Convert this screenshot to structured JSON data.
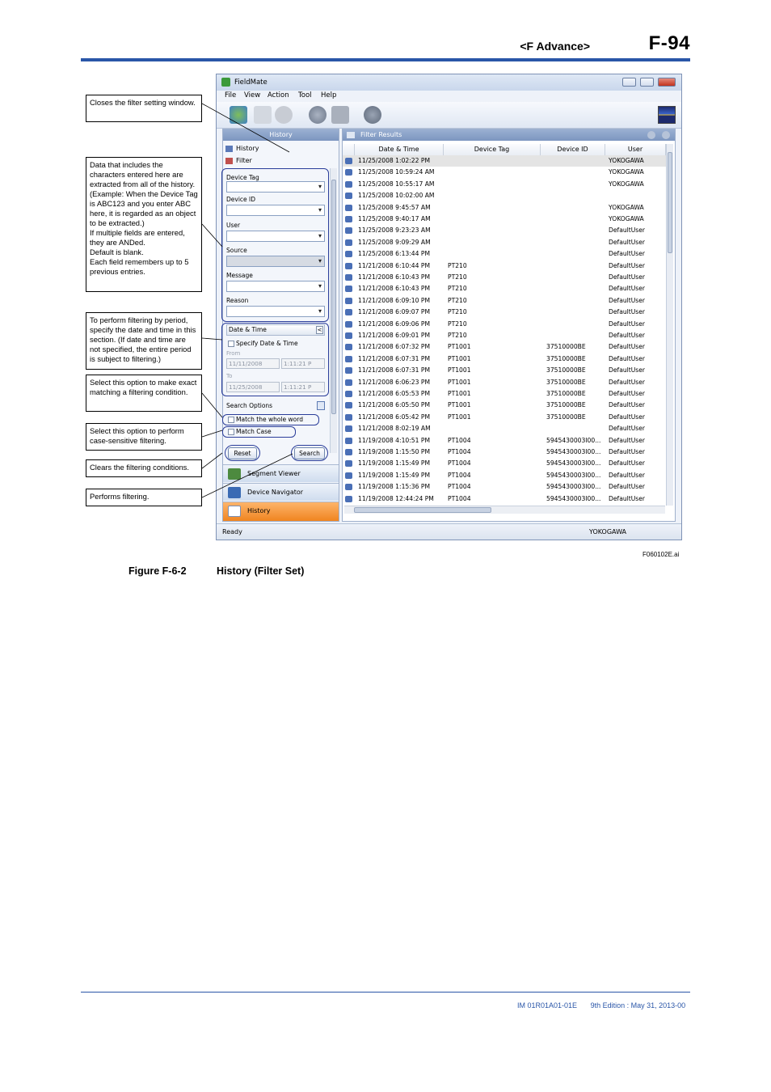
{
  "header": {
    "section": "<F  Advance>",
    "page": "F-94"
  },
  "window": {
    "title": "FieldMate",
    "menu": [
      "File",
      "View",
      "Action",
      "Tool",
      "Help"
    ],
    "left_panel": {
      "title": "History",
      "history_label": "History",
      "filter_label": "Filter",
      "fields": [
        "Device Tag",
        "Device ID",
        "User",
        "Source",
        "Message",
        "Reason"
      ],
      "datetime_section": "Date & Time",
      "specify_label": "Specify Date & Time",
      "from_label": "From",
      "from_date": "11/11/2008",
      "from_time": "1:11:21 P",
      "to_label": "To",
      "to_date": "11/25/2008",
      "to_time": "1:11:21 P",
      "search_options": "Search Options",
      "match_whole": "Match the whole word",
      "match_case": "Match Case",
      "reset_btn": "Reset",
      "search_btn": "Search",
      "nav": [
        "Segment Viewer",
        "Device Navigator",
        "History"
      ]
    },
    "results": {
      "title": "Filter Results",
      "columns": [
        "Date & Time",
        "Device Tag",
        "Device ID",
        "User"
      ],
      "rows": [
        [
          "11/25/2008 1:02:22 PM",
          "",
          "",
          "YOKOGAWA"
        ],
        [
          "11/25/2008 10:59:24 AM",
          "",
          "",
          "YOKOGAWA"
        ],
        [
          "11/25/2008 10:55:17 AM",
          "",
          "",
          "YOKOGAWA"
        ],
        [
          "11/25/2008 10:02:00 AM",
          "",
          "",
          ""
        ],
        [
          "11/25/2008 9:45:57 AM",
          "",
          "",
          "YOKOGAWA"
        ],
        [
          "11/25/2008 9:40:17 AM",
          "",
          "",
          "YOKOGAWA"
        ],
        [
          "11/25/2008 9:23:23 AM",
          "",
          "",
          "DefaultUser"
        ],
        [
          "11/25/2008 9:09:29 AM",
          "",
          "",
          "DefaultUser"
        ],
        [
          "11/25/2008 6:13:44 PM",
          "",
          "",
          "DefaultUser"
        ],
        [
          "11/21/2008 6:10:44 PM",
          "PT210",
          "",
          "DefaultUser"
        ],
        [
          "11/21/2008 6:10:43 PM",
          "PT210",
          "",
          "DefaultUser"
        ],
        [
          "11/21/2008 6:10:43 PM",
          "PT210",
          "",
          "DefaultUser"
        ],
        [
          "11/21/2008 6:09:10 PM",
          "PT210",
          "",
          "DefaultUser"
        ],
        [
          "11/21/2008 6:09:07 PM",
          "PT210",
          "",
          "DefaultUser"
        ],
        [
          "11/21/2008 6:09:06 PM",
          "PT210",
          "",
          "DefaultUser"
        ],
        [
          "11/21/2008 6:09:01 PM",
          "PT210",
          "",
          "DefaultUser"
        ],
        [
          "11/21/2008 6:07:32 PM",
          "PT1001",
          "37510000BE",
          "DefaultUser"
        ],
        [
          "11/21/2008 6:07:31 PM",
          "PT1001",
          "37510000BE",
          "DefaultUser"
        ],
        [
          "11/21/2008 6:07:31 PM",
          "PT1001",
          "37510000BE",
          "DefaultUser"
        ],
        [
          "11/21/2008 6:06:23 PM",
          "PT1001",
          "37510000BE",
          "DefaultUser"
        ],
        [
          "11/21/2008 6:05:53 PM",
          "PT1001",
          "37510000BE",
          "DefaultUser"
        ],
        [
          "11/21/2008 6:05:50 PM",
          "PT1001",
          "37510000BE",
          "DefaultUser"
        ],
        [
          "11/21/2008 6:05:42 PM",
          "PT1001",
          "37510000BE",
          "DefaultUser"
        ],
        [
          "11/21/2008 8:02:19 AM",
          "",
          "",
          "DefaultUser"
        ],
        [
          "11/19/2008 4:10:51 PM",
          "PT1004",
          "5945430003I00...",
          "DefaultUser"
        ],
        [
          "11/19/2008 1:15:50 PM",
          "PT1004",
          "5945430003I00...",
          "DefaultUser"
        ],
        [
          "11/19/2008 1:15:49 PM",
          "PT1004",
          "5945430003I00...",
          "DefaultUser"
        ],
        [
          "11/19/2008 1:15:49 PM",
          "PT1004",
          "5945430003I00...",
          "DefaultUser"
        ],
        [
          "11/19/2008 1:15:36 PM",
          "PT1004",
          "5945430003I00...",
          "DefaultUser"
        ],
        [
          "11/19/2008 12:44:24 PM",
          "PT1004",
          "5945430003I00...",
          "DefaultUser"
        ]
      ]
    },
    "status": {
      "left": "Ready",
      "user": "YOKOGAWA"
    }
  },
  "callouts": {
    "close_filter": "Closes the filter setting window.",
    "filter_fields": "Data that includes the characters entered here are extracted from all of the history.\n(Example: When the Device Tag is ABC123 and you enter ABC here, it is regarded as an object to be extracted.)\nIf multiple fields are entered, they are ANDed.\nDefault is blank.\nEach field remembers up to 5 previous entries.",
    "period": "To perform filtering by period, specify the date and time in this section. (If date and time are not specified, the entire period is subject to filtering.)",
    "exact": "Select this option to make exact matching a filtering condition.",
    "case": "Select this option to perform case-sensitive filtering.",
    "clears": "Clears the filtering conditions.",
    "performs": "Performs filtering."
  },
  "figure": {
    "file_id": "F060102E.ai",
    "number": "Figure F-6-2",
    "title": "History (Filter Set)"
  },
  "footer": {
    "doc": "IM 01R01A01-01E",
    "edition": "9th Edition : May 31, 2013-00"
  }
}
